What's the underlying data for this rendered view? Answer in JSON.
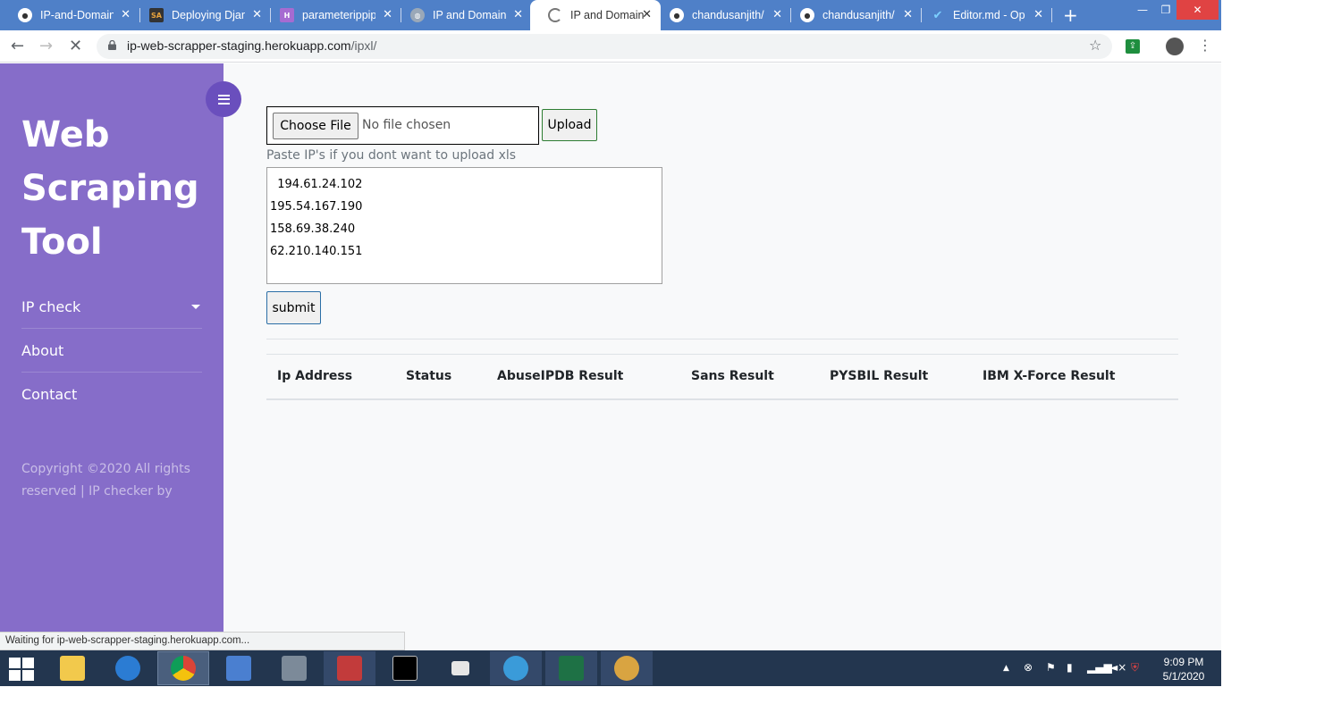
{
  "browser": {
    "tabs": [
      {
        "title": "IP-and-Domain",
        "icon": "github-icon"
      },
      {
        "title": "Deploying Djan",
        "icon": "sa-icon"
      },
      {
        "title": "parameterippip",
        "icon": "heroku-icon"
      },
      {
        "title": "IP and Domain",
        "icon": "globe-icon"
      },
      {
        "title": "IP and Domain",
        "icon": "loading-icon",
        "active": true
      },
      {
        "title": "chandusanjith/",
        "icon": "github-icon"
      },
      {
        "title": "chandusanjith/",
        "icon": "github-icon"
      },
      {
        "title": "Editor.md - Op",
        "icon": "editor-icon"
      }
    ],
    "url_host": "ip-web-scrapper-staging.herokuapp.com",
    "url_path": "/ipxl/",
    "status_text": "Waiting for ip-web-scrapper-staging.herokuapp.com..."
  },
  "sidebar": {
    "brand": "Web Scraping Tool",
    "menu": [
      "IP check",
      "About",
      "Contact"
    ],
    "copyright": "Copyright ©2020 All rights reserved | IP checker by"
  },
  "form": {
    "choose_file_label": "Choose File",
    "file_status": "No file chosen",
    "upload_label": "Upload",
    "paste_label": "Paste IP's if you dont want to upload xls",
    "ips": "  194.61.24.102\n195.54.167.190\n158.69.38.240\n62.210.140.151",
    "submit_label": "submit"
  },
  "table": {
    "columns": [
      "Ip Address",
      "Status",
      "AbuseIPDB Result",
      "Sans Result",
      "PYSBIL Result",
      "IBM X-Force Result"
    ]
  },
  "taskbar": {
    "time": "9:09 PM",
    "date": "5/1/2020"
  },
  "colors": {
    "sidebar": "#866dc9",
    "sidebar_toggle": "#6a4fbd",
    "tabstrip": "#4f80c8",
    "taskbar": "#23364f"
  }
}
